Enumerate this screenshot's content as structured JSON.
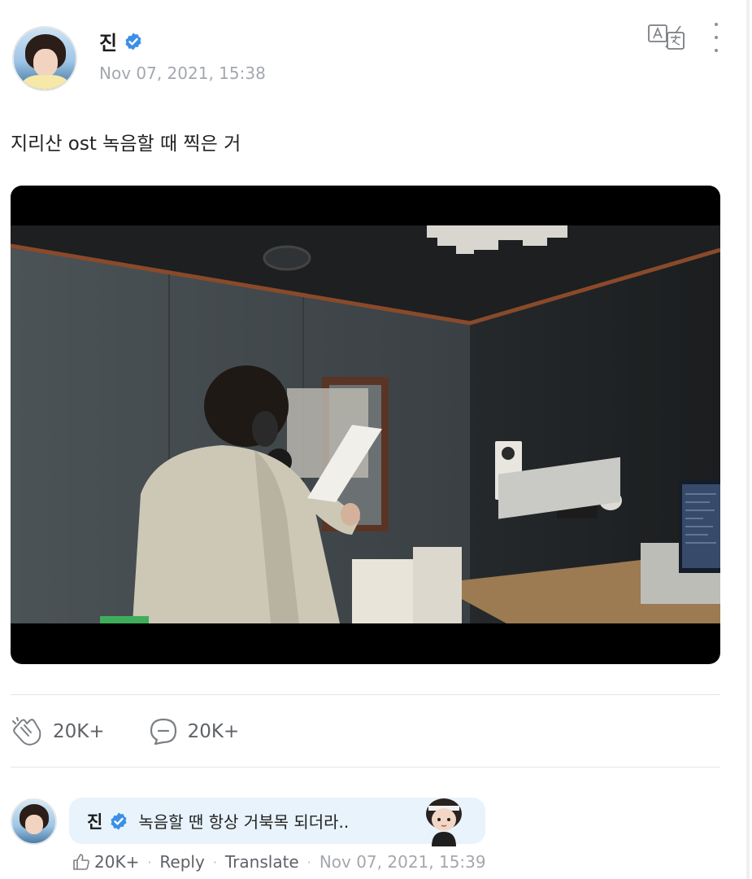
{
  "post": {
    "author": "진",
    "time": "Nov 07, 2021, 15:38",
    "text": "지리산 ost 녹음할 때 찍은 거",
    "likes": "20K+",
    "comments": "20K+"
  },
  "comment": {
    "author": "진",
    "text": "녹음할 땐 항상 거북목 되더라..",
    "likes": "20K+",
    "reply_label": "Reply",
    "translate_label": "Translate",
    "time": "Nov 07, 2021, 15:39"
  },
  "icons": {
    "verified": "verified-badge-icon",
    "translate": "translate-icon",
    "more": "more-vertical-icon",
    "like": "applause-icon",
    "comment": "comment-bubble-icon",
    "comment_like": "thumbs-up-icon"
  },
  "colors": {
    "verified": "#3b8fe6",
    "bubble": "#e8f3fb",
    "muted_text": "#a4a8ae"
  }
}
